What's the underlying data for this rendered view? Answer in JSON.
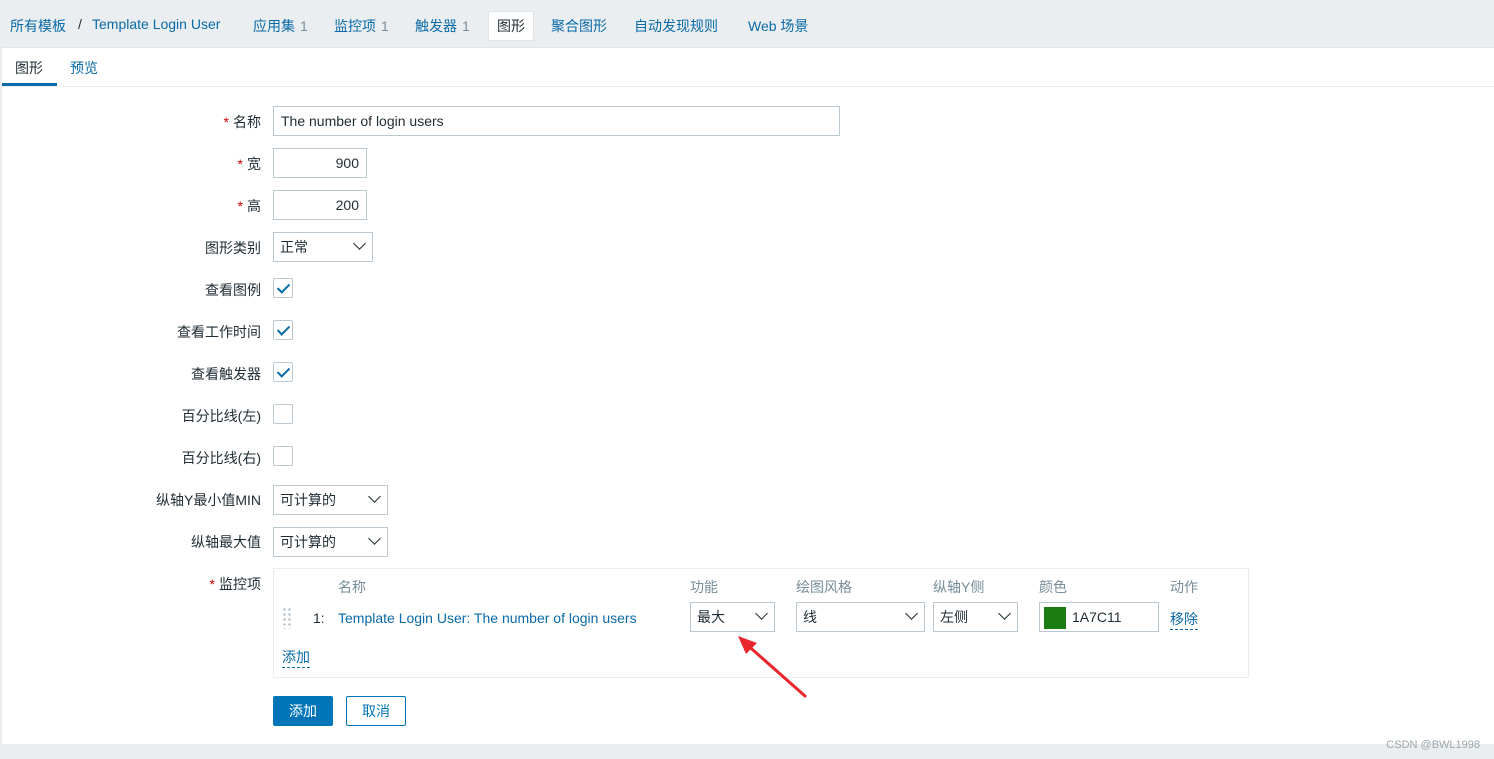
{
  "breadcrumb": {
    "all_templates": "所有模板",
    "separator": "/",
    "template": "Template Login User",
    "applications": {
      "label": "应用集",
      "count": "1"
    },
    "items": {
      "label": "监控项",
      "count": "1"
    },
    "triggers": {
      "label": "触发器",
      "count": "1"
    },
    "graphs": "图形",
    "screens": "聚合图形",
    "discovery": "自动发现规则",
    "web": "Web 场景"
  },
  "tabs": {
    "graph": "图形",
    "preview": "预览"
  },
  "form": {
    "name": {
      "label": "名称",
      "value": "The number of login users"
    },
    "width": {
      "label": "宽",
      "value": "900"
    },
    "height": {
      "label": "高",
      "value": "200"
    },
    "graph_type": {
      "label": "图形类别",
      "value": "正常"
    },
    "show_legend": {
      "label": "查看图例",
      "checked": true
    },
    "show_working_time": {
      "label": "查看工作时间",
      "checked": true
    },
    "show_triggers": {
      "label": "查看触发器",
      "checked": true
    },
    "percentile_left": {
      "label": "百分比线(左)",
      "checked": false
    },
    "percentile_right": {
      "label": "百分比线(右)",
      "checked": false
    },
    "y_min": {
      "label": "纵轴Y最小值MIN",
      "value": "可计算的"
    },
    "y_max": {
      "label": "纵轴最大值",
      "value": "可计算的"
    },
    "items_label": "监控项",
    "required_mark": "*"
  },
  "items_table": {
    "headers": {
      "name": "名称",
      "function": "功能",
      "draw_style": "绘图风格",
      "y_axis": "纵轴Y侧",
      "color": "颜色",
      "action": "动作"
    },
    "rows": [
      {
        "index": "1:",
        "name": "Template Login User: The number of login users",
        "function": "最大",
        "draw_style": "线",
        "y_axis": "左侧",
        "color": "1A7C11",
        "remove": "移除"
      }
    ],
    "add_link": "添加"
  },
  "buttons": {
    "add": "添加",
    "cancel": "取消"
  },
  "colors": {
    "accent": "#0275b8",
    "item_color": "#1A7C11",
    "arrow": "#e8262d"
  },
  "watermark": "CSDN @BWL1998"
}
